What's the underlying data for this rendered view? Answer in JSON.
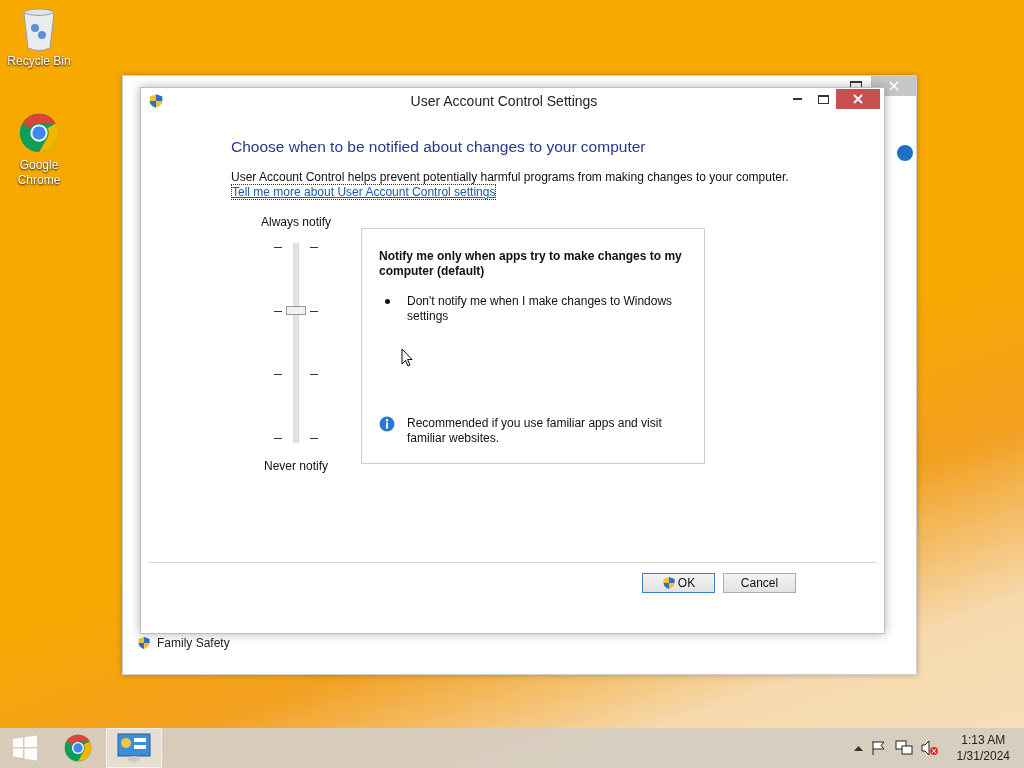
{
  "desktop_icons": [
    {
      "label": "Recycle Bin",
      "kind": "bin"
    },
    {
      "label": "Google Chrome",
      "kind": "chrome"
    }
  ],
  "background_window": {
    "items": [
      {
        "label": "Family Safety"
      }
    ]
  },
  "dialog": {
    "title": "User Account Control Settings",
    "heading": "Choose when to be notified about changes to your computer",
    "description": "User Account Control helps prevent potentially harmful programs from making changes to your computer.",
    "link": "Tell me more about User Account Control settings",
    "slider": {
      "top_label": "Always notify",
      "bottom_label": "Never notify",
      "level": 0.67
    },
    "info_panel": {
      "title": "Notify me only when apps try to make changes to my computer (default)",
      "bullets": [
        "Don't notify me when I make changes to Windows settings"
      ],
      "note": "Recommended if you use familiar apps and visit familiar websites."
    },
    "buttons": [
      {
        "label": "OK",
        "kind": "shield",
        "default": true
      },
      {
        "label": "Cancel",
        "kind": "plain",
        "default": false
      }
    ]
  },
  "taskbar": {
    "apps": [
      {
        "kind": "chrome",
        "active": false
      },
      {
        "kind": "control-panel",
        "active": true
      }
    ],
    "clock": {
      "time": "1:13 AM",
      "date": "1/31/2024"
    }
  }
}
